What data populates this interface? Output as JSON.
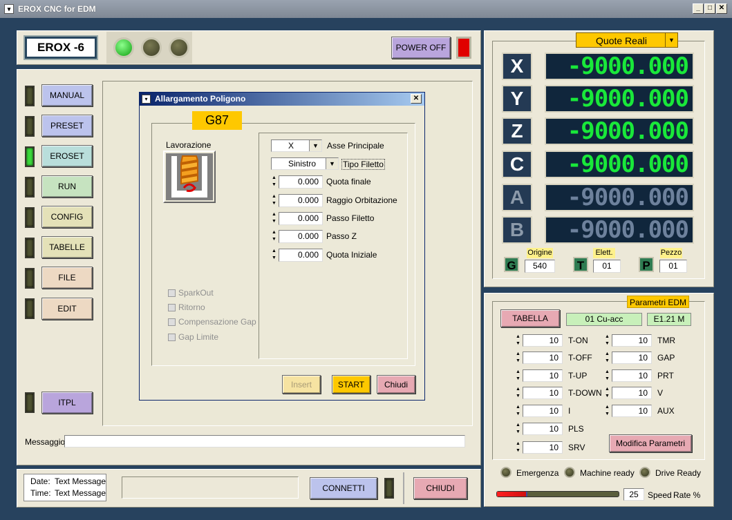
{
  "window": {
    "title": "EROX CNC for EDM"
  },
  "header": {
    "brand": "EROX -6",
    "power_off": "POWER OFF"
  },
  "sidebar": {
    "items": [
      {
        "label": "MANUAL"
      },
      {
        "label": "PRESET"
      },
      {
        "label": "EROSET"
      },
      {
        "label": "RUN"
      },
      {
        "label": "CONFIG"
      },
      {
        "label": "TABELLE"
      },
      {
        "label": "FILE"
      },
      {
        "label": "EDIT"
      },
      {
        "label": "ITPL"
      }
    ]
  },
  "dialog": {
    "title": "Allargamento Poligono",
    "code": "G87",
    "lavorazione": "Lavorazione",
    "asse_value": "X",
    "asse_label": "Asse Principale",
    "tipo_value": "Sinistro",
    "tipo_label": "Tipo Filetto",
    "params": [
      {
        "value": "0.000",
        "label": "Quota finale"
      },
      {
        "value": "0.000",
        "label": "Raggio Orbitazione"
      },
      {
        "value": "0.000",
        "label": "Passo Filetto"
      },
      {
        "value": "0.000",
        "label": "Passo Z"
      },
      {
        "value": "0.000",
        "label": "Quota Iniziale"
      }
    ],
    "checks": [
      "SparkOut",
      "Ritorno",
      "Compensazione Gap",
      "Gap Limite"
    ],
    "insert": "Insert",
    "start": "START",
    "chiudi": "Chiudi"
  },
  "message": {
    "label": "Messaggio",
    "value": ""
  },
  "footer": {
    "date_label": "Date:",
    "date_value": "Text Message",
    "time_label": "Time:",
    "time_value": "Text Message",
    "connetti": "CONNETTI",
    "chiudi": "CHIUDI"
  },
  "dro": {
    "mode": "Quote Reali",
    "axes": [
      {
        "name": "X",
        "value": "-9000.000"
      },
      {
        "name": "Y",
        "value": "-9000.000"
      },
      {
        "name": "Z",
        "value": "-9000.000"
      },
      {
        "name": "C",
        "value": "-9000.000"
      },
      {
        "name": "A",
        "value": "-9000.000"
      },
      {
        "name": "B",
        "value": "-9000.000"
      }
    ],
    "g_label": "G",
    "origine_label": "Origine",
    "origine_value": "540",
    "t_label": "T",
    "elett_label": "Elett.",
    "elett_value": "01",
    "p_label": "P",
    "pezzo_label": "Pezzo",
    "pezzo_value": "01"
  },
  "edm": {
    "title": "Parametri EDM",
    "tabella": "TABELLA",
    "material": "01 Cu-acc",
    "code": "E1.21 M",
    "left": [
      {
        "value": "10",
        "label": "T-ON"
      },
      {
        "value": "10",
        "label": "T-OFF"
      },
      {
        "value": "10",
        "label": "T-UP"
      },
      {
        "value": "10",
        "label": "T-DOWN"
      },
      {
        "value": "10",
        "label": "I"
      },
      {
        "value": "10",
        "label": "PLS"
      },
      {
        "value": "10",
        "label": "SRV"
      }
    ],
    "right": [
      {
        "value": "10",
        "label": "TMR"
      },
      {
        "value": "10",
        "label": "GAP"
      },
      {
        "value": "10",
        "label": "PRT"
      },
      {
        "value": "10",
        "label": "V"
      },
      {
        "value": "10",
        "label": "AUX"
      }
    ],
    "modifica": "Modifica Parametri"
  },
  "status": {
    "emergenza": "Emergenza",
    "machine_ready": "Machine ready",
    "drive_ready": "Drive Ready"
  },
  "speed": {
    "value": "25",
    "label": "Speed",
    "rate": "Rate %",
    "fraction": 0.25
  }
}
